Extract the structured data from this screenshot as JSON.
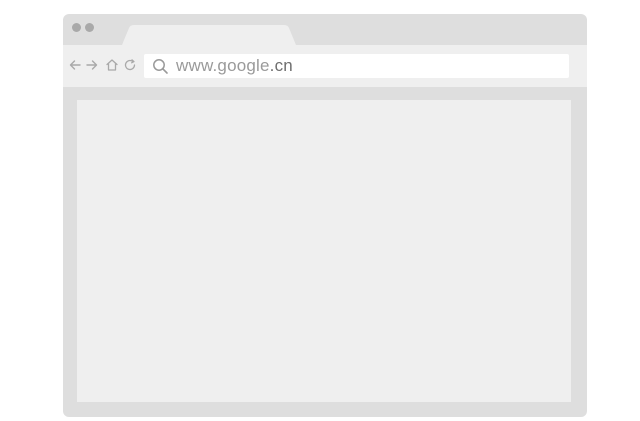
{
  "browser": {
    "titlebar": {
      "window_controls": [
        "window-dot",
        "window-dot"
      ]
    },
    "tab": {
      "title": ""
    },
    "toolbar": {
      "nav_icons": [
        "back-arrow-icon",
        "forward-arrow-icon",
        "home-icon",
        "reload-icon"
      ],
      "address_bar": {
        "search_icon": "search-icon",
        "url_host": "www.google",
        "url_tld": ".cn"
      }
    },
    "content": {
      "text": ""
    }
  },
  "colors": {
    "frame": "#dedede",
    "toolbar": "#efefef",
    "content": "#efefef",
    "address_bar": "#ffffff",
    "icon": "#a9a9a9",
    "url_host": "#9a9a9a",
    "url_tld": "#6f6f6f"
  }
}
